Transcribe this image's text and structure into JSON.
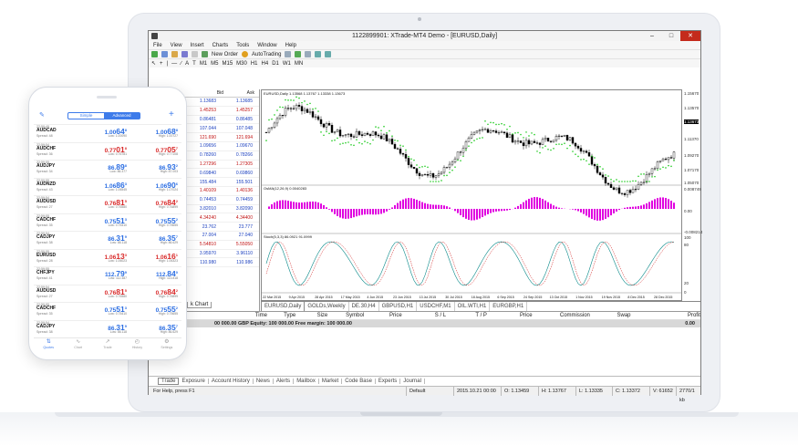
{
  "window": {
    "title": "1122899901: XTrade-MT4 Demo - [EURUSD,Daily]"
  },
  "menu": [
    "File",
    "View",
    "Insert",
    "Charts",
    "Tools",
    "Window",
    "Help"
  ],
  "toolbar": {
    "new_order": "New Order",
    "autotrading": "AutoTrading",
    "timeframes": [
      "M1",
      "M5",
      "M15",
      "M30",
      "H1",
      "H4",
      "D1",
      "W1",
      "MN"
    ]
  },
  "market_watch": {
    "header_time": ":10:19",
    "col_bid": "Bid",
    "col_ask": "Ask",
    "rows": [
      [
        "1.13683",
        "1.13685"
      ],
      [
        "1.45253",
        "1.45257"
      ],
      [
        "0.86481",
        "0.86485"
      ],
      [
        "107.044",
        "107.048"
      ],
      [
        "121.690",
        "121.694"
      ],
      [
        "1.09656",
        "1.09670"
      ],
      [
        "0.78260",
        "0.78266"
      ],
      [
        "1.27296",
        "1.27305"
      ],
      [
        "0.69840",
        "0.69860"
      ],
      [
        "155.484",
        "155.501"
      ],
      [
        "1.40109",
        "1.40136"
      ],
      [
        "0.74453",
        "0.74459"
      ],
      [
        "3.82010",
        "3.82090"
      ],
      [
        "4.34240",
        "4.34400"
      ],
      [
        "23.762",
        "23.777"
      ],
      [
        "27.004",
        "27.040"
      ],
      [
        "5.54810",
        "5.55050"
      ],
      [
        "3.95970",
        "3.96110"
      ],
      [
        "110.980",
        "110.986"
      ]
    ],
    "tab": "k Chart"
  },
  "chart": {
    "header": "EURUSD,Daily 1.13568 1.13767 1.13338 1.13673",
    "indicator1": "OsMA(12,26,9) 0.0040283",
    "indicator2": "Stoch(5,3,3) 86.0921 91.0999",
    "price_labels": [
      "1.15670",
      "1.13570",
      "1.13673",
      "1.11370",
      "1.09270",
      "1.07170",
      "1.05070",
      "0.008749",
      "0.00",
      "-0.008214",
      "100",
      "80",
      "20",
      "0"
    ],
    "dates": [
      "22 Mar 2015",
      "9 Apr 2015",
      "28 Apr 2015",
      "17 May 2015",
      "4 Jun 2015",
      "23 Jun 2015",
      "13 Jul 2015",
      "30 Jul 2015",
      "18 Aug 2015",
      "6 Sep 2015",
      "24 Sep 2015",
      "13 Oct 2015",
      "1 Nov 2015",
      "19 Nov 2015",
      "8 Dec 2015",
      "28 Dec 2015"
    ],
    "tabs": [
      "EURUSD,Daily",
      "GOLDs,Weekly",
      "DE.30,H4",
      "GBPUSD,H1",
      "USDCHF,M1",
      "OIL.WTI,H1",
      "EURGBP,H1"
    ],
    "colors": {
      "candle": "#000000",
      "sar": "#22cc22",
      "osma": "#e000e0",
      "stoch_main": "#0a8a8a",
      "stoch_signal": "#d01818"
    }
  },
  "terminal": {
    "cols": [
      "Time",
      "Type",
      "Size",
      "Symbol",
      "Price",
      "S / L",
      "T / P",
      "Price",
      "Commission",
      "Swap",
      "Profit"
    ],
    "balance_line": "00 000.00 GBP  Equity: 100 000.00  Free margin: 100 000.00",
    "profit": "0.00",
    "tabs": [
      "Trade",
      "Exposure",
      "Account History",
      "News",
      "Alerts",
      "Mailbox",
      "Market",
      "Code Base",
      "Experts",
      "Journal"
    ]
  },
  "status": {
    "help": "For Help, press F1",
    "profile": "Default",
    "datetime": "2015.10.21 00:00",
    "open": "O: 1.13459",
    "high": "H: 1.13767",
    "low": "L: 1.13335",
    "close": "C: 1.13372",
    "volume": "V: 61652",
    "traffic": "2770/1 kb"
  },
  "phone": {
    "seg_simple": "Simple",
    "seg_advanced": "Advanced",
    "quotes": [
      {
        "time": "22:59:49",
        "sym": "AUDCAD",
        "spread": "Spread: 48",
        "bid": "1.00",
        "bidbig": "64",
        "bidsup": "8",
        "ask": "1.00",
        "askbig": "68",
        "asksup": "8",
        "low": "Low: 1.00090",
        "high": "High: 1.00727",
        "c": "blue"
      },
      {
        "time": "22:59:54",
        "sym": "AUDCHF",
        "spread": "Spread: 36",
        "bid": "0.77",
        "bidbig": "01",
        "bidsup": "8",
        "ask": "0.77",
        "askbig": "05",
        "asksup": "7",
        "low": "Low: 0.76781",
        "high": "High: 0.77108",
        "c": "red"
      },
      {
        "time": "22:59:55",
        "sym": "AUDJPY",
        "spread": "Spread: 34",
        "bid": "86.",
        "bidbig": "89",
        "bidsup": "8",
        "ask": "86.",
        "askbig": "93",
        "asksup": "2",
        "low": "Low: 86.377",
        "high": "High: 87.003",
        "c": "blue"
      },
      {
        "time": "22:59:55",
        "sym": "AUDNZD",
        "spread": "Spread: 43",
        "bid": "1.06",
        "bidbig": "86",
        "bidsup": "3",
        "ask": "1.06",
        "askbig": "90",
        "asksup": "6",
        "low": "Low: 1.06545",
        "high": "High: 1.07024",
        "c": "blue"
      },
      {
        "time": "22:59:54",
        "sym": "AUDUSD",
        "spread": "Spread: 27",
        "bid": "0.76",
        "bidbig": "81",
        "bidsup": "5",
        "ask": "0.76",
        "askbig": "84",
        "asksup": "2",
        "low": "Low: 0.76580",
        "high": "High: 0.76899",
        "c": "red"
      },
      {
        "time": "22:59:55",
        "sym": "CADCHF",
        "spread": "Spread: 35",
        "bid": "0.75",
        "bidbig": "51",
        "bidsup": "3",
        "ask": "0.75",
        "askbig": "55",
        "asksup": "2",
        "low": "Low: 0.75410",
        "high": "High: 0.75655",
        "c": "blue"
      },
      {
        "time": "22:59:54",
        "sym": "CADJPY",
        "spread": "Spread: 38",
        "bid": "86.",
        "bidbig": "31",
        "bidsup": "9",
        "ask": "86.",
        "askbig": "35",
        "asksup": "7",
        "low": "Low: 86.118",
        "high": "High: 86.629",
        "c": "blue"
      },
      {
        "time": "22:59:55",
        "sym": "EURUSD",
        "spread": "Spread: 28",
        "bid": "1.06",
        "bidbig": "13",
        "bidsup": "3",
        "ask": "1.06",
        "askbig": "16",
        "asksup": "1",
        "low": "Low: 1.06023",
        "high": "High: 1.06323",
        "c": "red"
      },
      {
        "time": "22:59:55",
        "sym": "CHFJPY",
        "spread": "Spread: 41",
        "bid": "112.",
        "bidbig": "79",
        "bidsup": "9",
        "ask": "112.",
        "askbig": "84",
        "asksup": "0",
        "low": "Low: 112.487",
        "high": "High: 113.818",
        "c": "blue"
      },
      {
        "time": "22:59:54",
        "sym": "AUDUSD",
        "spread": "Spread: 27",
        "bid": "0.76",
        "bidbig": "81",
        "bidsup": "5",
        "ask": "0.76",
        "askbig": "84",
        "asksup": "2",
        "low": "Low: 0.76580",
        "high": "High: 0.76899",
        "c": "red"
      },
      {
        "time": "22:59:55",
        "sym": "CADCHF",
        "spread": "Spread: 35",
        "bid": "0.75",
        "bidbig": "51",
        "bidsup": "3",
        "ask": "0.75",
        "askbig": "55",
        "asksup": "2",
        "low": "Low: 0.75410",
        "high": "High: 0.75655",
        "c": "blue"
      },
      {
        "time": "22:59:54",
        "sym": "CADJPY",
        "spread": "Spread: 38",
        "bid": "86.",
        "bidbig": "31",
        "bidsup": "9",
        "ask": "86.",
        "askbig": "35",
        "asksup": "7",
        "low": "Low: 86.118",
        "high": "High: 86.629",
        "c": "blue"
      }
    ],
    "nav": [
      "Quotes",
      "Chart",
      "Trade",
      "History",
      "Settings"
    ]
  }
}
